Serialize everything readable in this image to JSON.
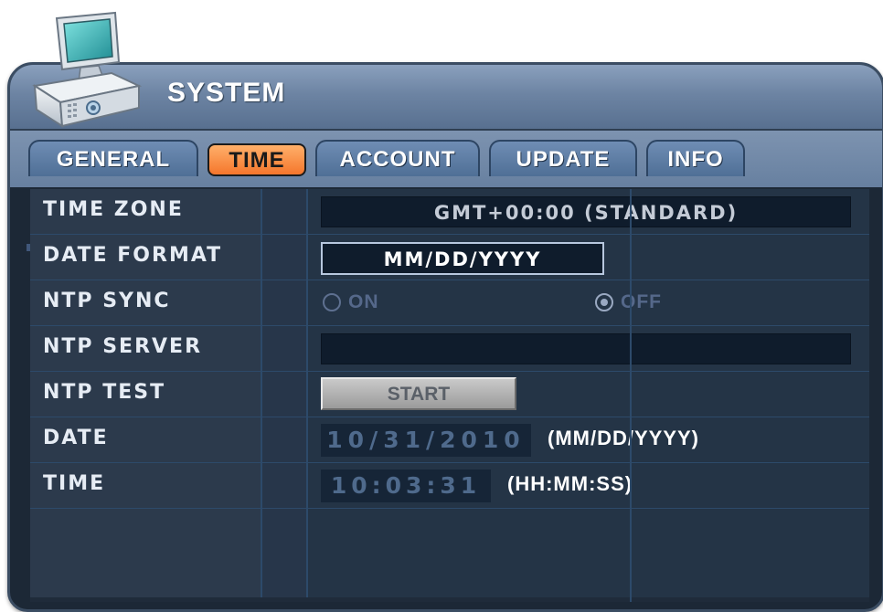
{
  "window": {
    "title": "SYSTEM"
  },
  "tabs": [
    {
      "label": "GENERAL",
      "active": false
    },
    {
      "label": "TIME",
      "active": true
    },
    {
      "label": "ACCOUNT",
      "active": false
    },
    {
      "label": "UPDATE",
      "active": false
    },
    {
      "label": "INFO",
      "active": false
    }
  ],
  "rows": {
    "time_zone": {
      "label": "TIME ZONE",
      "value": "GMT+00:00 (STANDARD)"
    },
    "date_format": {
      "label": "DATE FORMAT",
      "value": "MM/DD/YYYY"
    },
    "ntp_sync": {
      "label": "NTP SYNC",
      "on_label": "ON",
      "off_label": "OFF",
      "selected": "OFF"
    },
    "ntp_server": {
      "label": "NTP SERVER",
      "value": ""
    },
    "ntp_test": {
      "label": "NTP TEST",
      "button": "START"
    },
    "date": {
      "label": "DATE",
      "value": "10/31/2010",
      "hint": "(MM/DD/YYYY)"
    },
    "time": {
      "label": "TIME",
      "value": "10:03:31",
      "hint": "(HH:MM:SS)"
    }
  },
  "colors": {
    "active_tab": "#f5762c",
    "panel_bg": "#1f2b3a",
    "titlebar": "#6d84a3"
  },
  "icons": {
    "header": "computer-monitor-icon"
  }
}
